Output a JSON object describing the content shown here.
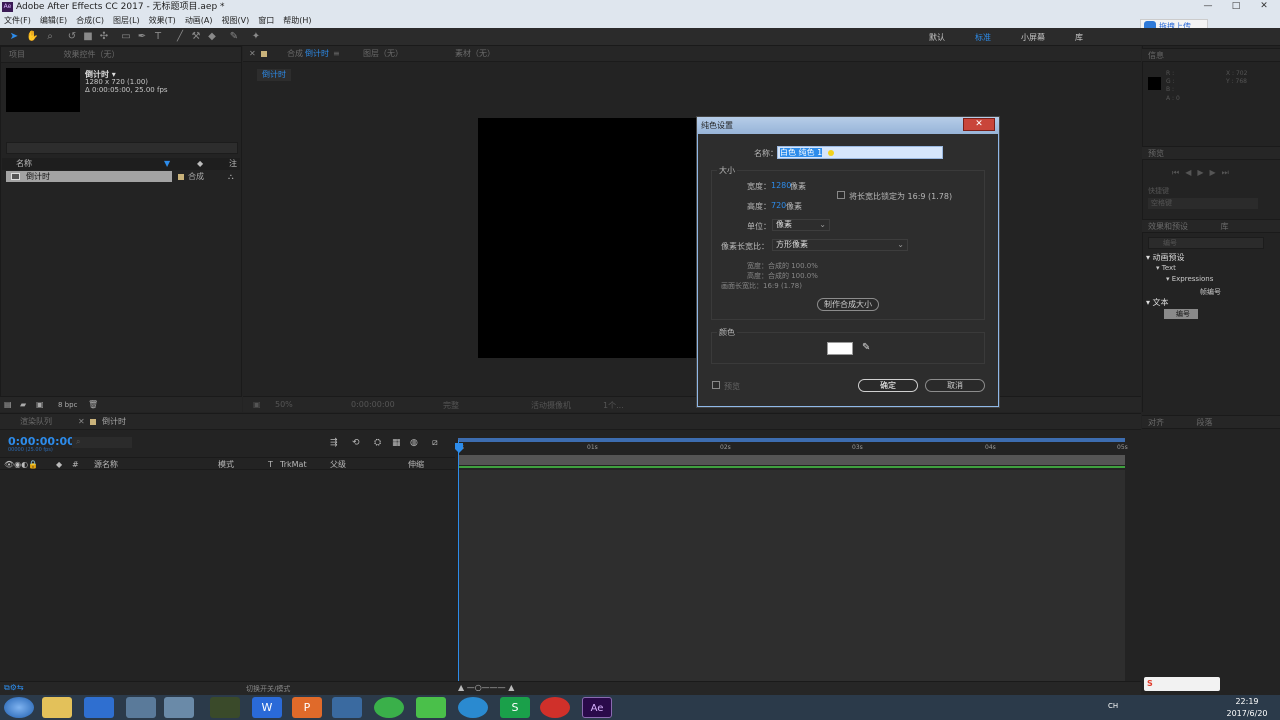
{
  "window": {
    "title": "Adobe After Effects CC 2017 - 无标题项目.aep *",
    "app_icon": "Ae"
  },
  "menu": [
    "文件(F)",
    "编辑(E)",
    "合成(C)",
    "图层(L)",
    "效果(T)",
    "动画(A)",
    "视图(V)",
    "窗口",
    "帮助(H)"
  ],
  "workspaces": {
    "default": "默认",
    "standard": "标准",
    "small": "小屏幕",
    "library": "库"
  },
  "upload_label": "拖拽上传",
  "project": {
    "tab_project": "项目",
    "tab_effects": "效果控件（无）",
    "comp_name": "倒计时 ▾",
    "comp_dim": "1280 x 720 (1.00)",
    "comp_dur": "Δ 0:00:05:00, 25.00 fps",
    "col_name": "名称",
    "col_note": "注",
    "row_name": "倒计时",
    "row_type": "合成",
    "bpc": "8 bpc"
  },
  "comp_panel": {
    "tab_comp": "合成",
    "tab_comp_name": "倒计时",
    "tab_layer": "图层（无）",
    "tab_footage": "素材（无）",
    "subtab": "倒计时",
    "zoom": "50%",
    "time": "0:00:00:00",
    "resolution": "完整",
    "camera": "活动摄像机",
    "views": "1个..."
  },
  "right_panel": {
    "info": "信息",
    "coord_x": "X : 702",
    "coord_y": "Y : 768",
    "r": "R :",
    "g": "G :",
    "b": "B :",
    "a": "A : 0",
    "preview": "预览",
    "shortcut": "快捷键",
    "shortcut_value": "空格键",
    "effects_presets": "效果和预设",
    "library": "库",
    "search_value": "编号",
    "tree": [
      "▾ 动画预设",
      "▾ Text",
      "▾ Expressions",
      "帧编号",
      "▾ 文本",
      "编号"
    ],
    "align": "对齐",
    "paragraph": "段落"
  },
  "dialog": {
    "title": "纯色设置",
    "close": "✕",
    "name_label": "名称：",
    "name_value": "白色 纯色 1",
    "size_group": "大小",
    "width_label": "宽度：",
    "width_value": "1280",
    "width_unit": "像素",
    "height_label": "高度：",
    "height_value": "720",
    "height_unit": "像素",
    "lock_ratio": "将长宽比锁定为 16:9 (1.78)",
    "units_label": "单位：",
    "units_value": "像素",
    "par_label": "像素长宽比：",
    "par_value": "方形像素",
    "w_comp": "宽度：合成的 100.0%",
    "h_comp": "高度：合成的 100.0%",
    "frame_ratio": "画面长宽比：16:9 (1.78)",
    "make_comp_size": "制作合成大小",
    "color_group": "颜色",
    "swatch_color": "#ffffff",
    "preview": "预览",
    "ok": "确定",
    "cancel": "取消"
  },
  "timeline": {
    "tab_render": "渲染队列",
    "tab_comp": "倒计时",
    "time": "0:00:00:00",
    "fps": "00000 (25.00 fps)",
    "cols": {
      "hash": "#",
      "source": "源名称",
      "mode": "模式",
      "t": "T",
      "trkmat": "TrkMat",
      "parent": "父级",
      "stretch": "伸缩"
    },
    "ticks": [
      "0s",
      "01s",
      "02s",
      "03s",
      "04s",
      "05s"
    ],
    "toggle": "切换开关/模式"
  },
  "taskbar": {
    "time": "22:19",
    "date": "2017/6/20",
    "lang": "CH"
  }
}
